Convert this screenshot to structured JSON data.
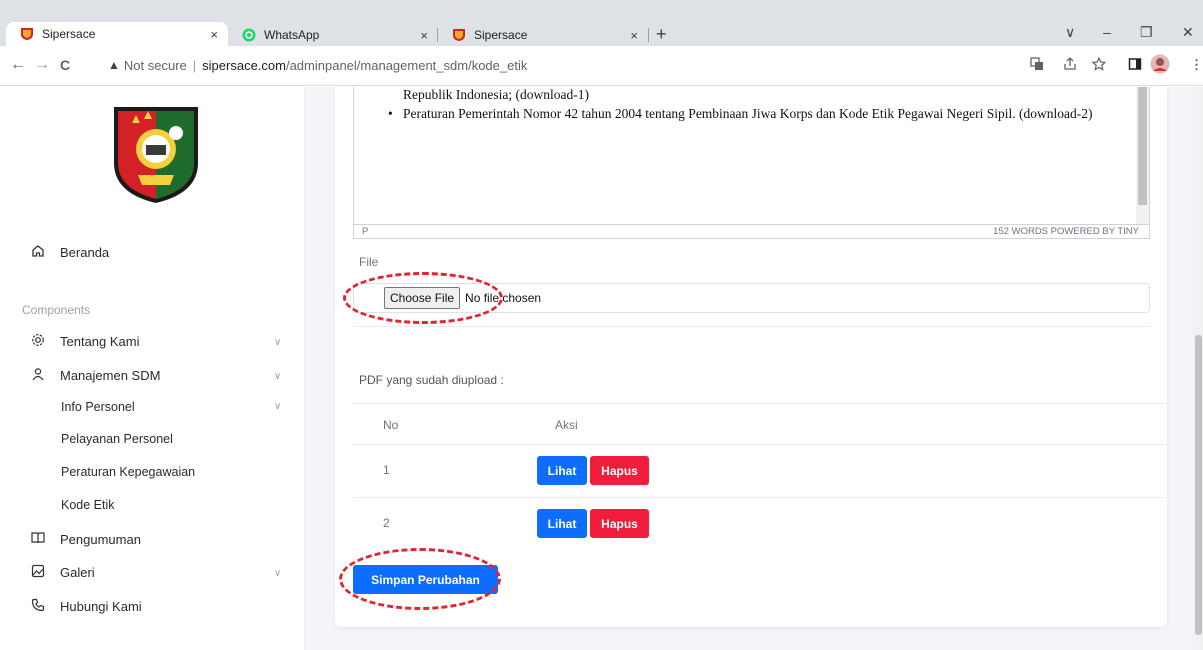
{
  "browser": {
    "tabs": [
      {
        "title": "Sipersace",
        "close": "×"
      },
      {
        "title": "WhatsApp",
        "close": "×"
      },
      {
        "title": "Sipersace",
        "close": "×"
      }
    ],
    "new_tab": "+",
    "window_controls": {
      "dropdown": "∨",
      "minimize": "–",
      "restore": "❐",
      "close": "✕"
    },
    "nav": {
      "back": "←",
      "forward": "→",
      "reload": "C"
    },
    "omnibox": {
      "security_icon": "▲",
      "not_secure": "Not secure",
      "separator": "|",
      "domain": "sipersace.com",
      "path": "/adminpanel/management_sdm/kode_etik"
    },
    "toolbar_icons": [
      "translate-icon",
      "share-icon",
      "star-icon",
      "sidepanel-icon",
      "profile-icon",
      "menu-icon"
    ]
  },
  "sidebar": {
    "home": {
      "label": "Beranda",
      "icon": "home-icon"
    },
    "section_label": "Components",
    "items": [
      {
        "label": "Tentang Kami",
        "icon": "gear-icon",
        "chevron": "∨"
      },
      {
        "label": "Manajemen SDM",
        "icon": "user-icon",
        "chevron": "∨"
      },
      {
        "label": "Info Personel",
        "chevron": "∨"
      },
      {
        "label": "Pelayanan Personel"
      },
      {
        "label": "Peraturan Kepegawaian"
      },
      {
        "label": "Kode Etik"
      },
      {
        "label": "Pengumuman",
        "icon": "book-icon"
      },
      {
        "label": "Galeri",
        "icon": "image-icon",
        "chevron": "∨"
      },
      {
        "label": "Hubungi Kami",
        "icon": "phone-icon"
      }
    ]
  },
  "editor": {
    "line1": "Republik Indonesia; (download-1)",
    "bullet_dot": "•",
    "bullet": "Peraturan Pemerintah Nomor 42 tahun 2004 tentang Pembinaan Jiwa Korps dan Kode Etik Pegawai Negeri Sipil. (download-2)",
    "status_p": "P",
    "status_words": "152 WORDS  POWERED BY TINY"
  },
  "file": {
    "label": "File",
    "choose_button": "Choose File",
    "no_file": "No file chosen"
  },
  "pdf": {
    "label": "PDF yang sudah diupload :",
    "headers": {
      "no": "No",
      "aksi": "Aksi"
    },
    "rows": [
      {
        "no": "1",
        "view": "Lihat",
        "delete": "Hapus"
      },
      {
        "no": "2",
        "view": "Lihat",
        "delete": "Hapus"
      }
    ]
  },
  "save_button": "Simpan Perubahan",
  "colors": {
    "primary": "#0d6efd",
    "danger": "#f01e3c",
    "annotation": "#e0252e"
  }
}
